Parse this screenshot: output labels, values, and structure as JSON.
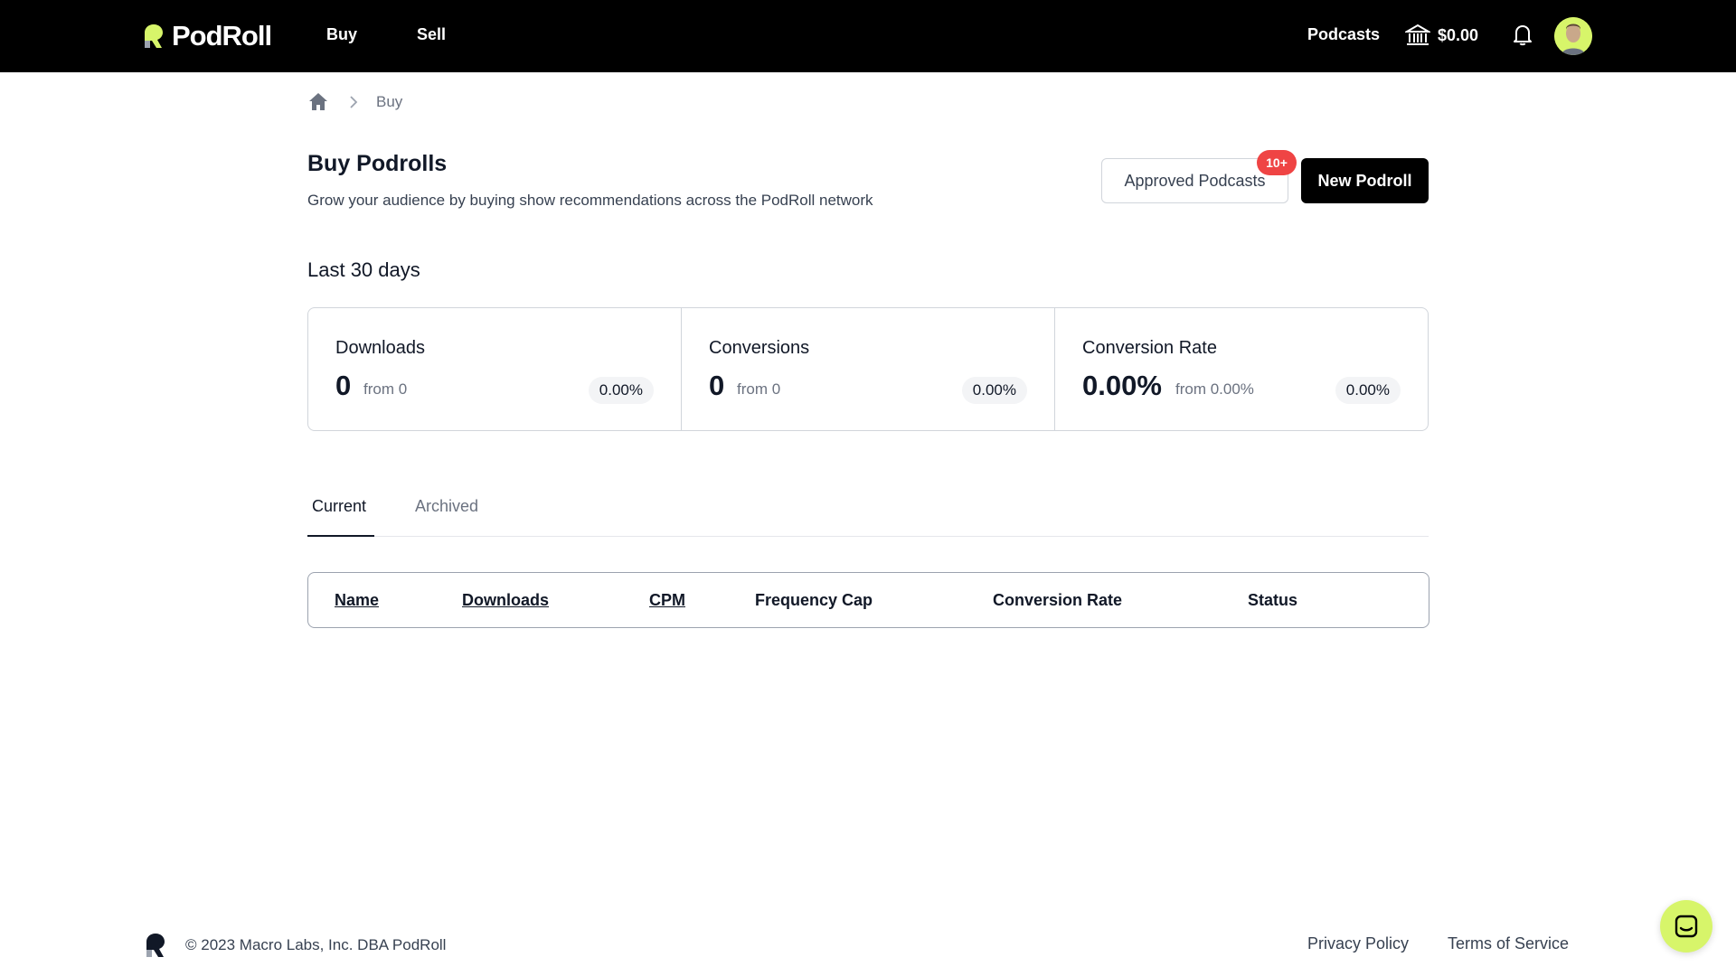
{
  "brand": {
    "name": "PodRoll",
    "accent": "#d7f56a"
  },
  "nav": {
    "buy": "Buy",
    "sell": "Sell",
    "podcasts": "Podcasts",
    "balance": "$0.00"
  },
  "breadcrumb": {
    "current": "Buy"
  },
  "header": {
    "title": "Buy Podrolls",
    "subtitle": "Grow your audience by buying show recommendations across the PodRoll network",
    "approved_label": "Approved Podcasts",
    "approved_badge": "10+",
    "new_label": "New Podroll"
  },
  "period": "Last 30 days",
  "stats": [
    {
      "label": "Downloads",
      "value": "0",
      "from": "from 0",
      "change": "0.00%"
    },
    {
      "label": "Conversions",
      "value": "0",
      "from": "from 0",
      "change": "0.00%"
    },
    {
      "label": "Conversion Rate",
      "value": "0.00%",
      "from": "from 0.00%",
      "change": "0.00%"
    }
  ],
  "tabs": {
    "current": "Current",
    "archived": "Archived"
  },
  "table": {
    "columns": [
      "Name",
      "Downloads",
      "CPM",
      "Frequency Cap",
      "Conversion Rate",
      "Status"
    ]
  },
  "footer": {
    "copyright": "© 2023 Macro Labs, Inc. DBA PodRoll",
    "privacy": "Privacy Policy",
    "terms": "Terms of Service"
  }
}
